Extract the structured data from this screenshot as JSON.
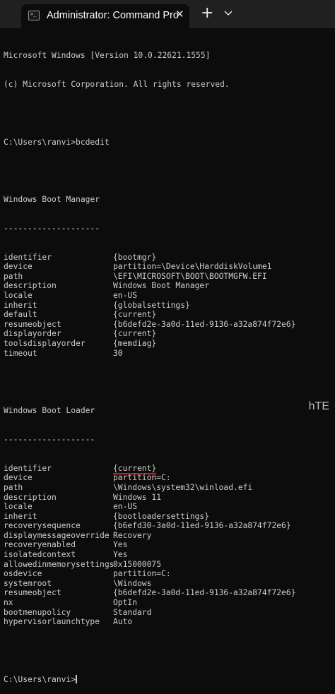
{
  "window": {
    "tab_title": "Administrator: Command Pro",
    "close_glyph": "✕",
    "new_tab_glyph": "+",
    "icon": "terminal-icon"
  },
  "console": {
    "banner": [
      "Microsoft Windows [Version 10.0.22621.1555]",
      "(c) Microsoft Corporation. All rights reserved."
    ],
    "prompt_command": "C:\\Users\\ranvi>bcdedit",
    "boot_manager": {
      "heading": "Windows Boot Manager",
      "rule": "--------------------",
      "entries": [
        {
          "key": "identifier",
          "value": "{bootmgr}"
        },
        {
          "key": "device",
          "value": "partition=\\Device\\HarddiskVolume1"
        },
        {
          "key": "path",
          "value": "\\EFI\\MICROSOFT\\BOOT\\BOOTMGFW.EFI"
        },
        {
          "key": "description",
          "value": "Windows Boot Manager"
        },
        {
          "key": "locale",
          "value": "en-US"
        },
        {
          "key": "inherit",
          "value": "{globalsettings}"
        },
        {
          "key": "default",
          "value": "{current}"
        },
        {
          "key": "resumeobject",
          "value": "{b6defd2e-3a0d-11ed-9136-a32a874f72e6}"
        },
        {
          "key": "displayorder",
          "value": "{current}"
        },
        {
          "key": "toolsdisplayorder",
          "value": "{memdiag}"
        },
        {
          "key": "timeout",
          "value": "30"
        }
      ]
    },
    "boot_loader": {
      "heading": "Windows Boot Loader",
      "rule": "-------------------",
      "entries": [
        {
          "key": "identifier",
          "value": "{current}"
        },
        {
          "key": "device",
          "value": "partition=C:"
        },
        {
          "key": "path",
          "value": "\\Windows\\system32\\winload.efi"
        },
        {
          "key": "description",
          "value": "Windows 11"
        },
        {
          "key": "locale",
          "value": "en-US"
        },
        {
          "key": "inherit",
          "value": "{bootloadersettings}"
        },
        {
          "key": "recoverysequence",
          "value": "{b6efd30-3a0d-11ed-9136-a32a874f72e6}"
        },
        {
          "key": "displaymessageoverride",
          "value": "Recovery"
        },
        {
          "key": "recoveryenabled",
          "value": "Yes"
        },
        {
          "key": "isolatedcontext",
          "value": "Yes"
        },
        {
          "key": "allowedinmemorysettings",
          "value": "0x15000075"
        },
        {
          "key": "osdevice",
          "value": "partition=C:"
        },
        {
          "key": "systemroot",
          "value": "\\Windows"
        },
        {
          "key": "resumeobject",
          "value": "{b6defd2e-3a0d-11ed-9136-a32a874f72e6}"
        },
        {
          "key": "nx",
          "value": "OptIn"
        },
        {
          "key": "bootmenupolicy",
          "value": "Standard"
        },
        {
          "key": "hypervisorlaunchtype",
          "value": "Auto"
        }
      ]
    },
    "final_prompt": "C:\\Users\\ranvi>"
  },
  "watermark": "hTE",
  "colors": {
    "background": "#0c0c0c",
    "tabbar": "#202020",
    "text": "#cccccc",
    "highlight_underline": "#e81123"
  }
}
